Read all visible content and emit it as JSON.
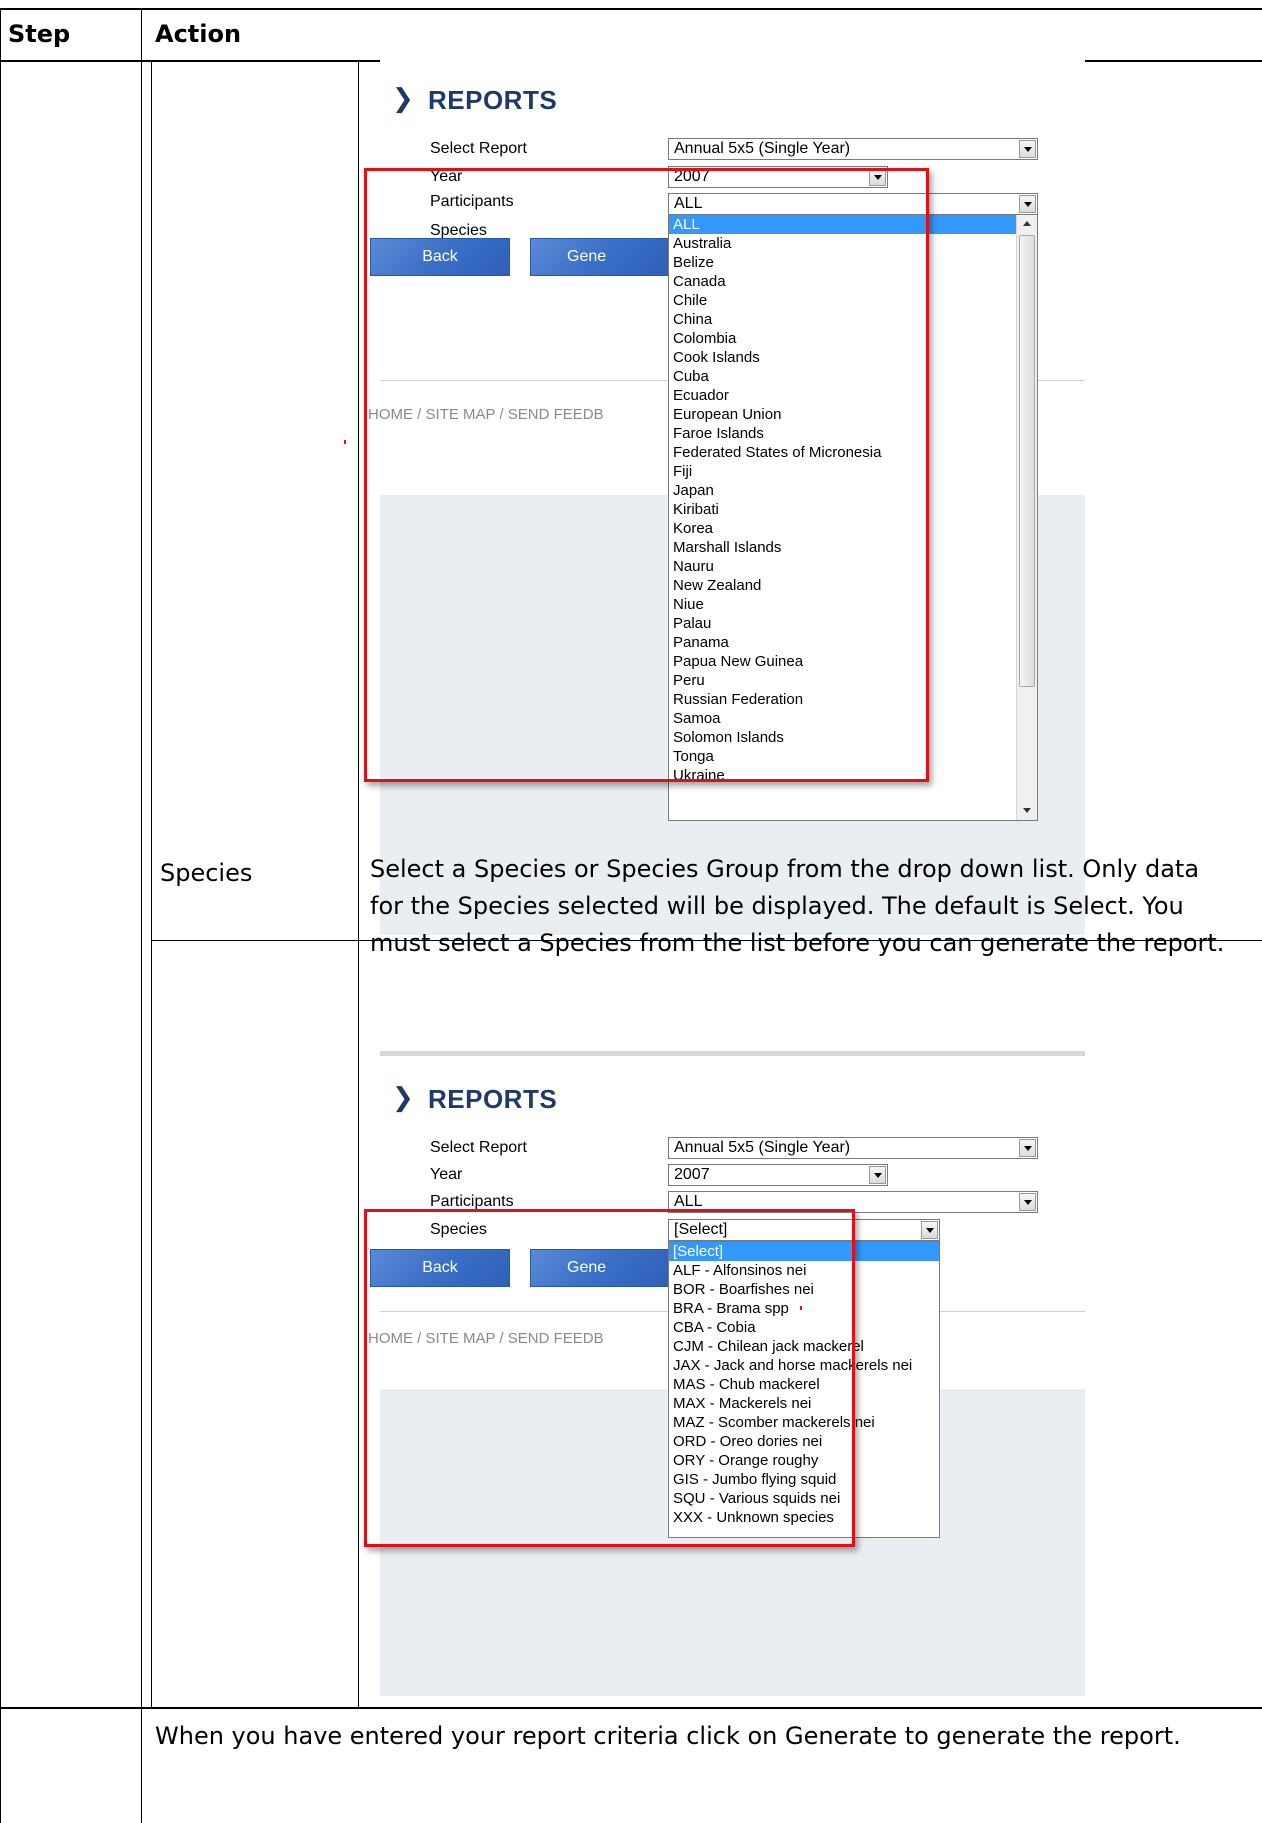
{
  "table": {
    "header_step": "Step",
    "header_action": "Action",
    "species_label": "Species",
    "species_description": [
      "Select a Species or Species Group from the drop down list. Only data",
      "for the Species selected will be displayed. The default is Select. You",
      "must select a Species from the list before you can generate the report."
    ],
    "final_note": "When you have entered your report criteria click on Generate to generate the report."
  },
  "shot1": {
    "title": "REPORTS",
    "labels": {
      "select_report": "Select Report",
      "year": "Year",
      "participants": "Participants",
      "species": "Species"
    },
    "values": {
      "select_report": "Annual 5x5 (Single Year)",
      "year": "2007",
      "participants": "ALL"
    },
    "back_button": "Back",
    "generate_button": "Gene",
    "footer": "HOME / SITE MAP / SEND FEEDB",
    "dropdown_items": [
      "ALL",
      "Australia",
      "Belize",
      "Canada",
      "Chile",
      "China",
      "Colombia",
      "Cook Islands",
      "Cuba",
      "Ecuador",
      "European Union",
      "Faroe Islands",
      "Federated States of Micronesia",
      "Fiji",
      "Japan",
      "Kiribati",
      "Korea",
      "Marshall Islands",
      "Nauru",
      "New Zealand",
      "Niue",
      "Palau",
      "Panama",
      "Papua New Guinea",
      "Peru",
      "Russian Federation",
      "Samoa",
      "Solomon Islands",
      "Tonga",
      "Ukraine"
    ],
    "selected_item": "ALL"
  },
  "shot2": {
    "title": "REPORTS",
    "labels": {
      "select_report": "Select Report",
      "year": "Year",
      "participants": "Participants",
      "species": "Species"
    },
    "values": {
      "select_report": "Annual 5x5 (Single Year)",
      "year": "2007",
      "participants": "ALL",
      "species": "[Select]"
    },
    "back_button": "Back",
    "generate_button": "Gene",
    "footer": "HOME / SITE MAP / SEND FEEDB",
    "dropdown_items": [
      "[Select]",
      "ALF - Alfonsinos nei",
      "BOR - Boarfishes nei",
      "BRA - Brama spp",
      "CBA - Cobia",
      "CJM - Chilean jack mackerel",
      "JAX - Jack and horse mackerels nei",
      "MAS - Chub mackerel",
      "MAX - Mackerels nei",
      "MAZ - Scomber mackerels nei",
      "ORD - Oreo dories nei",
      "ORY - Orange roughy",
      "GIS - Jumbo flying squid",
      "SQU - Various squids nei",
      "XXX - Unknown species"
    ],
    "selected_item": "[Select]"
  },
  "colors": {
    "highlight_red": "#e0101a",
    "reports_blue": "#1f3a6a",
    "selection_blue": "#3399ff",
    "button_blue": "#3b6fc6"
  }
}
